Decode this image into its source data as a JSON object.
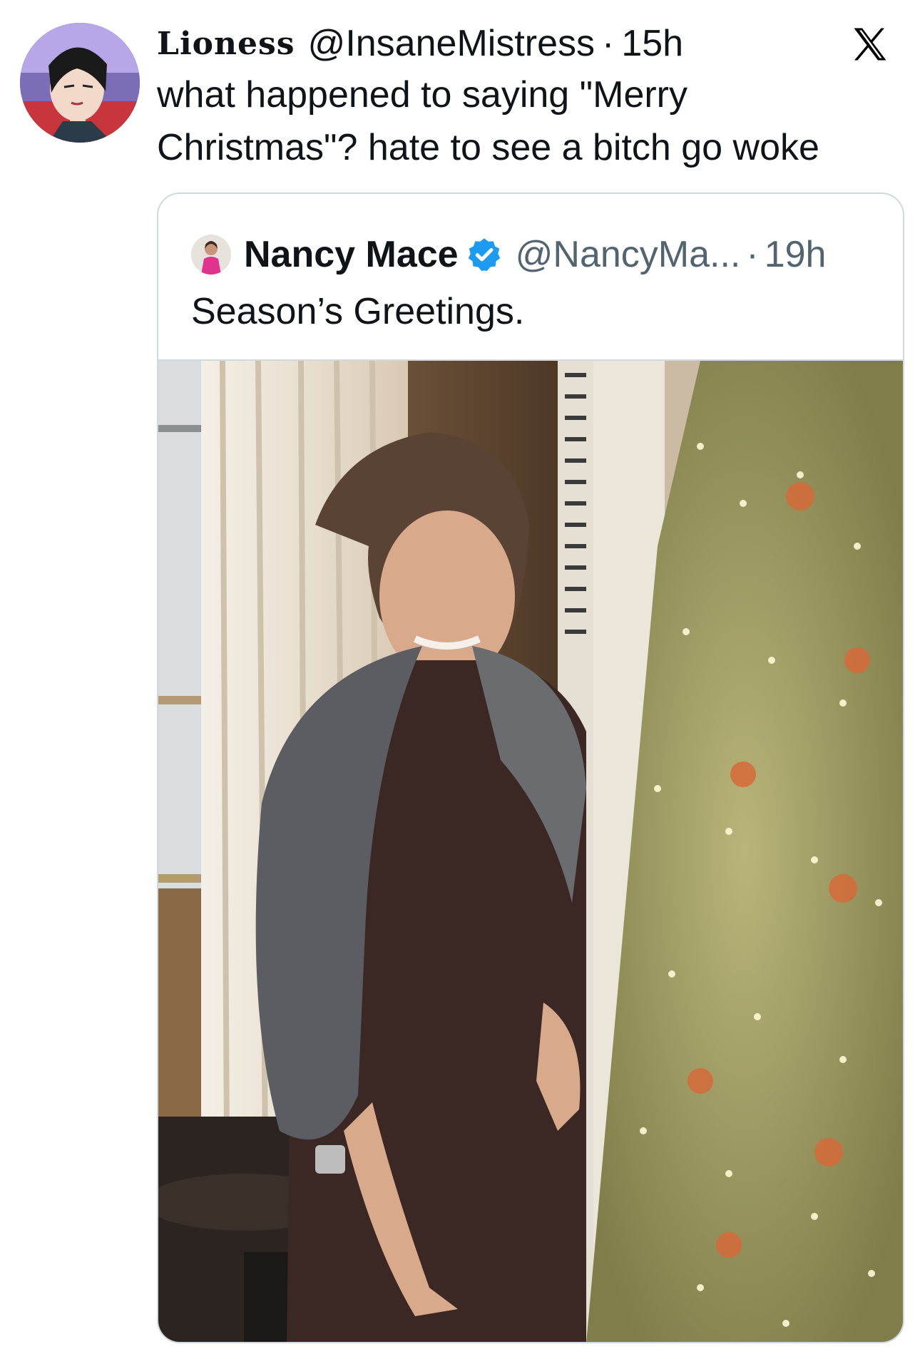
{
  "tweet": {
    "display_name": "Lioness",
    "handle": "@InsaneMistress",
    "time": "15h",
    "text": "what happened to saying \"Merry Christmas\"? hate to see a bitch go woke",
    "avatar_icon": "cartoon-avatar"
  },
  "quoted": {
    "display_name": "Nancy Mace",
    "handle": "@NancyMa...",
    "time": "19h",
    "text": "Season’s Greetings.",
    "verified": true,
    "verified_color": "#1d9bf0"
  },
  "icons": {
    "logo": "x-logo-icon",
    "verified": "verified-badge-icon"
  }
}
